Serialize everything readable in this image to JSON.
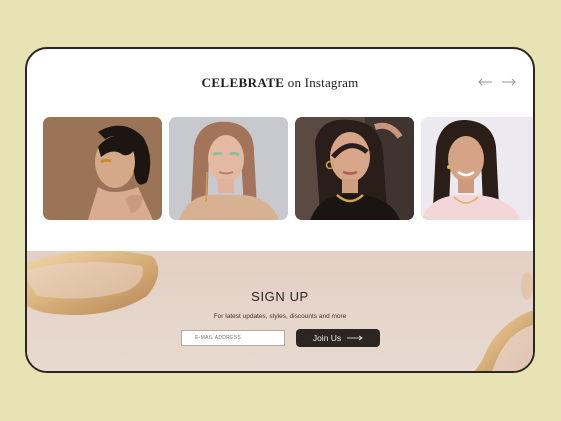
{
  "instagram": {
    "title_bold": "CELEBRATE",
    "title_rest": " on Instagram",
    "prev_icon": "arrow-left-icon",
    "next_icon": "arrow-right-icon",
    "photos": [
      {
        "alt": "Woman with gold eye makeup and earrings"
      },
      {
        "alt": "Woman with green eye makeup and gold earrings"
      },
      {
        "alt": "Woman with gold chain necklace"
      },
      {
        "alt": "Smiling woman with necklace"
      }
    ]
  },
  "signup": {
    "title": "SIGN UP",
    "subtitle": "For latest updates, styles, discounts and more",
    "email_placeholder": "E-MAIL ADDRESS",
    "button_label": "Join Us"
  },
  "colors": {
    "background": "#e8e3b4",
    "dark": "#2b2621",
    "signup_bg": "#e3cfc3"
  }
}
